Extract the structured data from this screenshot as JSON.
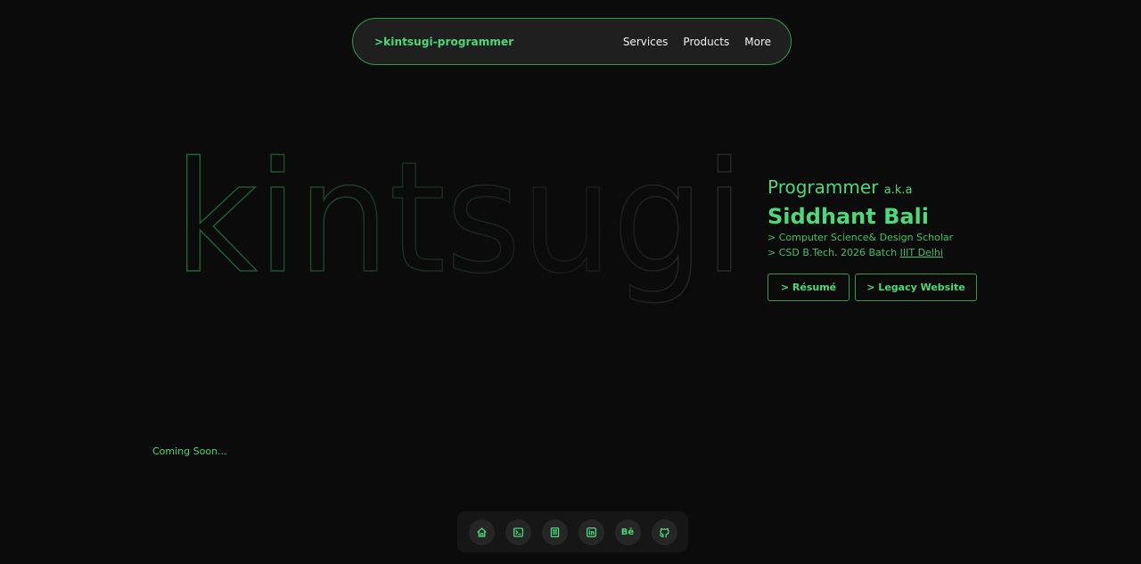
{
  "nav": {
    "brand": ">kintsugi-programmer",
    "links": [
      "Services",
      "Products",
      "More"
    ]
  },
  "hero": {
    "word": "kintsugi"
  },
  "profile": {
    "role": "Programmer",
    "aka": "a.k.a",
    "name": "Siddhant Bali",
    "line1": "> Computer Science& Design Scholar",
    "line2_prefix": "> CSD B.Tech. 2026 Batch ",
    "line2_link": "IIIT Delhi",
    "resume_label": "> Résumé",
    "legacy_label": "> Legacy Website"
  },
  "coming_soon": "Coming Soon...",
  "dock": {
    "items": [
      "home-icon",
      "terminal-icon",
      "document-icon",
      "linkedin-icon",
      "behance-icon",
      "github-icon"
    ],
    "behance_text": "Bē"
  },
  "colors": {
    "accent": "#4cd97a",
    "border": "#2f9a52",
    "background": "#0b0b0b"
  }
}
